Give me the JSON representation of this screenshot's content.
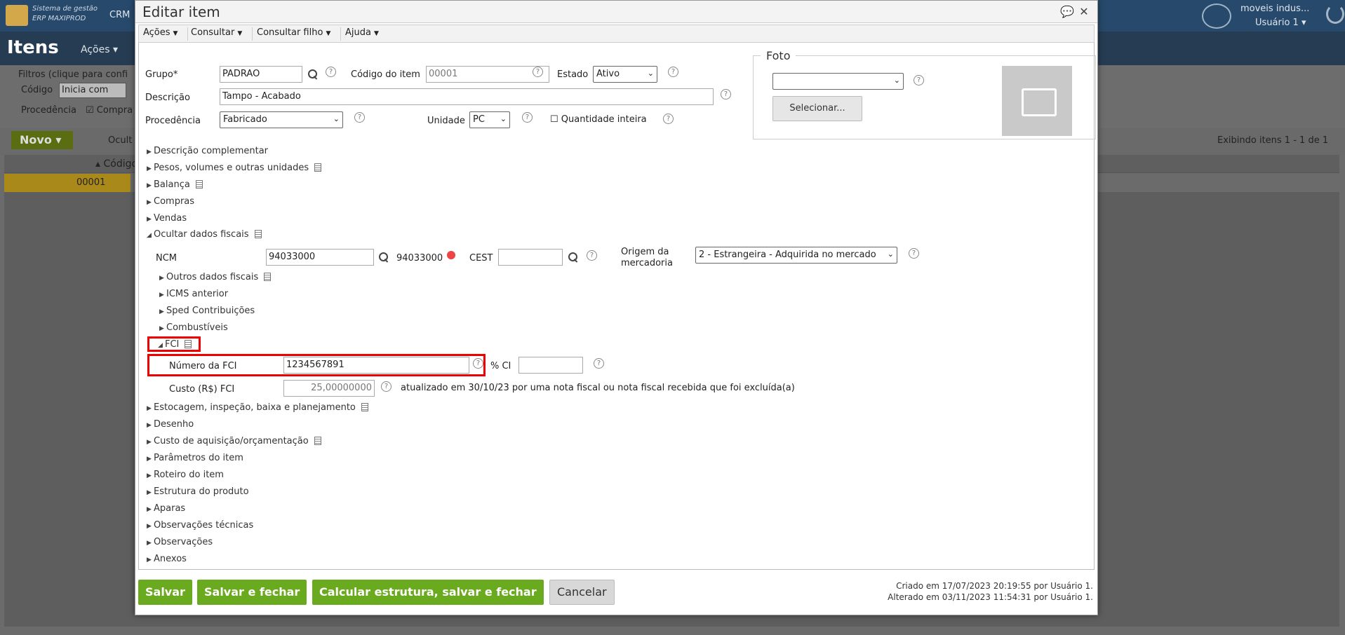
{
  "background": {
    "brand_line1": "Sistema de gestão",
    "brand_line2": "ERP MAXIPROD",
    "crm": "CRM",
    "company": "moveis indus...",
    "user": "Usuário 1",
    "page_title": "Itens",
    "acoes": "Ações",
    "filters_label": "Filtros (clique para confi",
    "codigo_label": "Código",
    "codigo_select": "Inicia com",
    "procedencia_label": "Procedência",
    "compra_check": "Compra",
    "novo_button": "Novo",
    "ocult": "Ocult",
    "exibindo": "Exibindo itens 1 - 1 de 1",
    "col_codigo": "Código",
    "row_codigo": "00001"
  },
  "modal": {
    "title": "Editar item",
    "menu": [
      "Ações",
      "Consultar",
      "Consultar filho",
      "Ajuda"
    ],
    "grupo_label": "Grupo*",
    "grupo_value": "PADRAO",
    "codigo_item_label": "Código do item",
    "codigo_item_value": "00001",
    "estado_label": "Estado",
    "estado_value": "Ativo",
    "descricao_label": "Descrição",
    "descricao_value": "Tampo - Acabado",
    "procedencia_label": "Procedência",
    "procedencia_value": "Fabricado",
    "unidade_label": "Unidade",
    "unidade_value": "PC",
    "qtd_inteira_label": "Quantidade inteira",
    "foto_legend": "Foto",
    "foto_select_value": "",
    "selecionar_button": "Selecionar...",
    "sections_top": [
      "Descrição complementar",
      "Pesos, volumes e outras unidades",
      "Balança",
      "Compras",
      "Vendas",
      "Ocultar dados fiscais"
    ],
    "ncm_label": "NCM",
    "ncm_value": "94033000",
    "ncm_display": "94033000",
    "cest_label": "CEST",
    "cest_value": "",
    "origem_label_1": "Origem da",
    "origem_label_2": "mercadoria",
    "origem_value": "2 - Estrangeira - Adquirida no mercado",
    "fiscal_sub": [
      "Outros dados fiscais",
      "ICMS anterior",
      "Sped Contribuições",
      "Combustíveis"
    ],
    "fci_section": "FCI",
    "numero_fci_label": "Número da FCI",
    "numero_fci_value": "1234567891",
    "ci_label": "% CI",
    "ci_value": "",
    "custo_fci_label": "Custo (R$) FCI",
    "custo_fci_value": "25,00000000",
    "custo_note": "atualizado em 30/10/23 por uma nota fiscal ou nota fiscal recebida que foi excluída(a)",
    "sections_bottom": [
      "Estocagem, inspeção, baixa e planejamento",
      "Desenho",
      "Custo de aquisição/orçamentação",
      "Parâmetros do item",
      "Roteiro do item",
      "Estrutura do produto",
      "Aparas",
      "Observações técnicas",
      "Observações",
      "Anexos"
    ],
    "btn_salvar": "Salvar",
    "btn_salvar_fechar": "Salvar e fechar",
    "btn_calcular": "Calcular estrutura, salvar e fechar",
    "btn_cancelar": "Cancelar",
    "criado": "Criado em 17/07/2023 20:19:55 por Usuário 1.",
    "alterado": "Alterado em 03/11/2023 11:54:31 por Usuário 1."
  }
}
